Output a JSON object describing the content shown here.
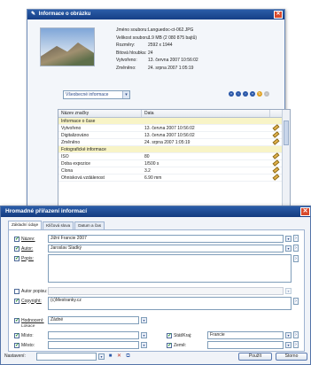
{
  "top_window": {
    "title": "Informace o obrázku",
    "properties": [
      {
        "key": "Jméno souboru:",
        "value": "Languedoc-ct-062.JPG"
      },
      {
        "key": "Velikost souboru:",
        "value": "1.9 MB (2 080 875 bajtů)"
      },
      {
        "key": "Rozměry:",
        "value": "2592 x 1944"
      },
      {
        "key": "Bitová hloubka:",
        "value": "24"
      },
      {
        "key": "Vytvořeno:",
        "value": "13. června 2007 10:56:02"
      },
      {
        "key": "Změněno:",
        "value": "24. srpna 2007 1:05:19"
      }
    ],
    "combo_value": "Všeobecné informace",
    "grid_headers": [
      "Název značky",
      "Data"
    ],
    "grid_rows": [
      {
        "name": "Informace o čase",
        "value": "",
        "group": true,
        "edit": false
      },
      {
        "name": "Vytvořeno",
        "value": "13. června 2007 10:56:02",
        "group": false,
        "edit": true
      },
      {
        "name": "Digitalizováno",
        "value": "13. června 2007 10:56:02",
        "group": false,
        "edit": true
      },
      {
        "name": "Změněno",
        "value": "24. srpna 2007 1:05:19",
        "group": false,
        "edit": true
      },
      {
        "name": "Fotografické informace",
        "value": "",
        "group": true,
        "edit": false
      },
      {
        "name": "ISO",
        "value": "80",
        "group": false,
        "edit": true
      },
      {
        "name": "Doba expozice",
        "value": "1/500 s",
        "group": false,
        "edit": true
      },
      {
        "name": "Clona",
        "value": "3.2",
        "group": false,
        "edit": true
      },
      {
        "name": "Ohnisková vzdálenost",
        "value": "6.90 mm",
        "group": false,
        "edit": true
      }
    ]
  },
  "bottom_window": {
    "title": "Hromadné přiřazení informací",
    "tabs": [
      "Základní údaje",
      "Klíčová slova",
      "Datum a čas"
    ],
    "fields": {
      "title_label": "Název:",
      "title_value": "Jižní Francie 2007",
      "author_label": "Autor:",
      "author_value": "Jaroslav Sladký",
      "description_label": "Popis:",
      "description_value": "",
      "author_desc_label": "Autor popisu:",
      "author_desc_value": "",
      "copyright_label": "Copyright:",
      "copyright_value": "(c)Mestranky.cz",
      "rating_label": "Hodnocení:",
      "rating_value": "Žádné",
      "location_label": "Lokace",
      "place_label": "Místo:",
      "place_value": "",
      "city_label": "Město:",
      "city_value": "",
      "state_label": "Stát/Kraj:",
      "state_value": "Francie",
      "country_label": "Země:",
      "country_value": ""
    },
    "footer": {
      "settings_label": "Nastavení:",
      "settings_value": "",
      "apply_label": "Použít",
      "cancel_label": "Storno"
    }
  }
}
